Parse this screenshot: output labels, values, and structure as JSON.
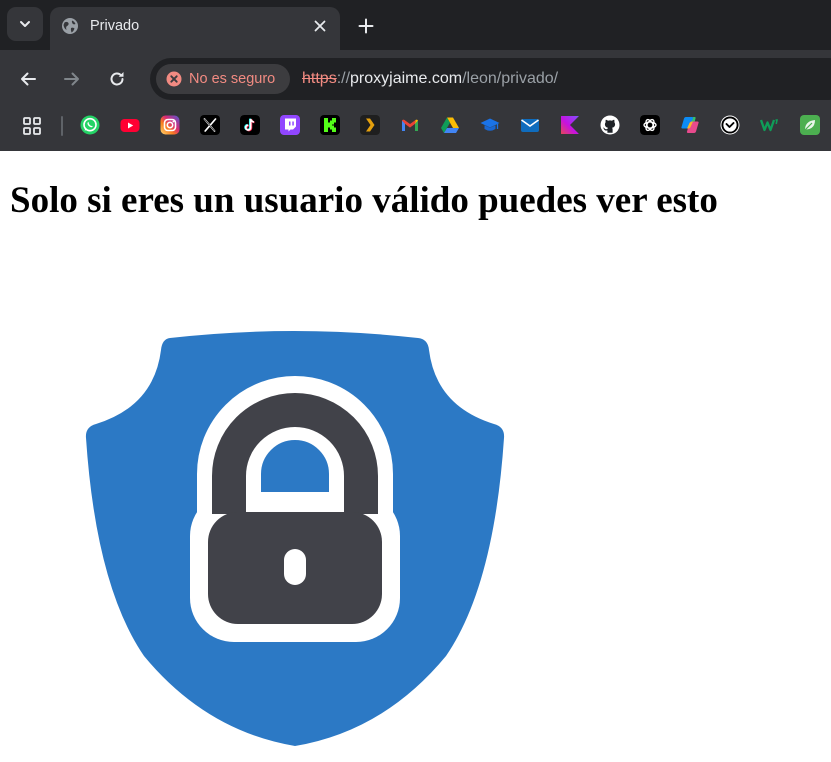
{
  "browser": {
    "tab": {
      "title": "Privado",
      "favicon": "globe-icon"
    },
    "new_tab_icon": "plus-icon",
    "security_chip": {
      "label": "No es seguro",
      "icon": "not-secure-icon",
      "color": "#f28b82"
    },
    "url": {
      "scheme": "https",
      "separator": "://",
      "host": "proxyjaime.com",
      "path": "/leon/privado/"
    },
    "bookmarks": [
      "whatsapp-icon",
      "youtube-icon",
      "instagram-icon",
      "x-icon",
      "tiktok-icon",
      "twitch-icon",
      "kick-icon",
      "plex-icon",
      "gmail-icon",
      "google-drive-icon",
      "graduation-cap-icon",
      "mail-icon",
      "kotlin-icon",
      "github-icon",
      "chatgpt-icon",
      "microsoft-copilot-icon",
      "checkmark-circle-icon",
      "w-icon",
      "leaf-icon"
    ]
  },
  "page": {
    "heading": "Solo si eres un usuario válido puedes ver esto",
    "image": "shield-lock-icon",
    "colors": {
      "shield": "#2c79c5",
      "lock": "#414249"
    }
  }
}
